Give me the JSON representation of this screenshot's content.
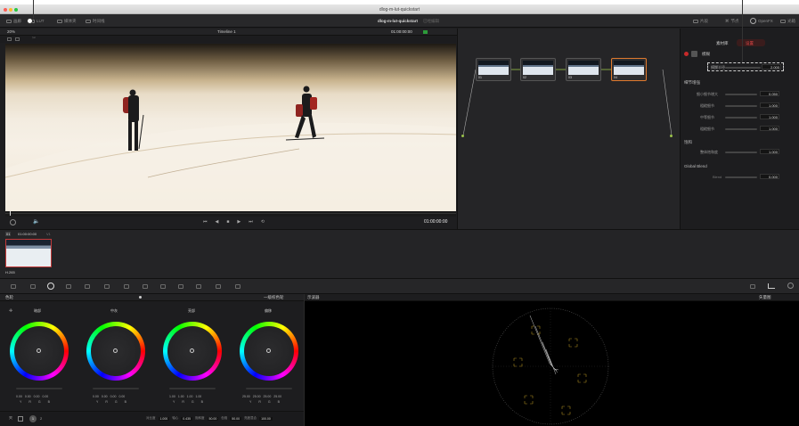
{
  "window": {
    "title": "dlog-m-lut-quickstart"
  },
  "toolbar": {
    "left": [
      "画廊",
      "LUT",
      "媒体夹",
      "时间线"
    ],
    "project_title": "dlog-m-lut-quickstart",
    "project_sub": "已经编辑",
    "right": [
      "片段",
      "节点",
      "OpenFX",
      "光箱"
    ]
  },
  "viewbar": {
    "zoom": "20%",
    "timeline": "Timeline 1",
    "timecode": "01:00:00:00",
    "clips_label": "片段"
  },
  "transport": {
    "timecode": "01:00:00:00"
  },
  "clipbar": {
    "clip_num": "01",
    "clip_tc": "01:00:00:00",
    "clip_track": "V1",
    "codec": "H.265"
  },
  "nodes": [
    {
      "label": "01"
    },
    {
      "label": "02"
    },
    {
      "label": "03"
    },
    {
      "label": "04"
    }
  ],
  "keyer": {
    "tabs": [
      "素材库",
      "设置"
    ],
    "section_header": "模糊",
    "radius_label": "模糊半径",
    "radius_value": "2.000",
    "sections": [
      {
        "title": "细节增强",
        "rows": [
          {
            "label": "细小细节增大",
            "value": "0.050"
          },
          {
            "label": "粗糙细节",
            "value": "1.000"
          },
          {
            "label": "中等细节",
            "value": "1.000"
          },
          {
            "label": "粗糙细节",
            "value": "1.000"
          }
        ]
      },
      {
        "title": "饱和",
        "rows": [
          {
            "label": "整体饱和度",
            "value": "1.000"
          }
        ]
      },
      {
        "title": "Global Blend",
        "rows": [
          {
            "label": "Blend",
            "value": "0.000"
          }
        ]
      }
    ]
  },
  "color": {
    "title": "色轮",
    "mode": "一级校色轮",
    "wheels": [
      {
        "name": "暗部",
        "values": [
          "0.00",
          "0.00",
          "0.00",
          "0.00"
        ]
      },
      {
        "name": "中灰",
        "values": [
          "0.00",
          "0.00",
          "0.00",
          "0.00"
        ]
      },
      {
        "name": "亮部",
        "values": [
          "1.00",
          "1.00",
          "1.00",
          "1.00"
        ]
      },
      {
        "name": "偏移",
        "values": [
          "25.00",
          "25.00",
          "25.00",
          "25.00"
        ]
      }
    ],
    "channels": [
      "Y",
      "R",
      "G",
      "B"
    ],
    "bottom": [
      {
        "label": "对比度",
        "value": "1.000"
      },
      {
        "label": "轴心",
        "value": "0.435"
      },
      {
        "label": "饱和度",
        "value": "50.00"
      },
      {
        "label": "色相",
        "value": "50.00"
      },
      {
        "label": "亮度混合",
        "value": "100.00"
      }
    ],
    "page_nums": [
      "1",
      "2"
    ]
  },
  "scope": {
    "title": "示波器",
    "mode": "矢量图"
  }
}
